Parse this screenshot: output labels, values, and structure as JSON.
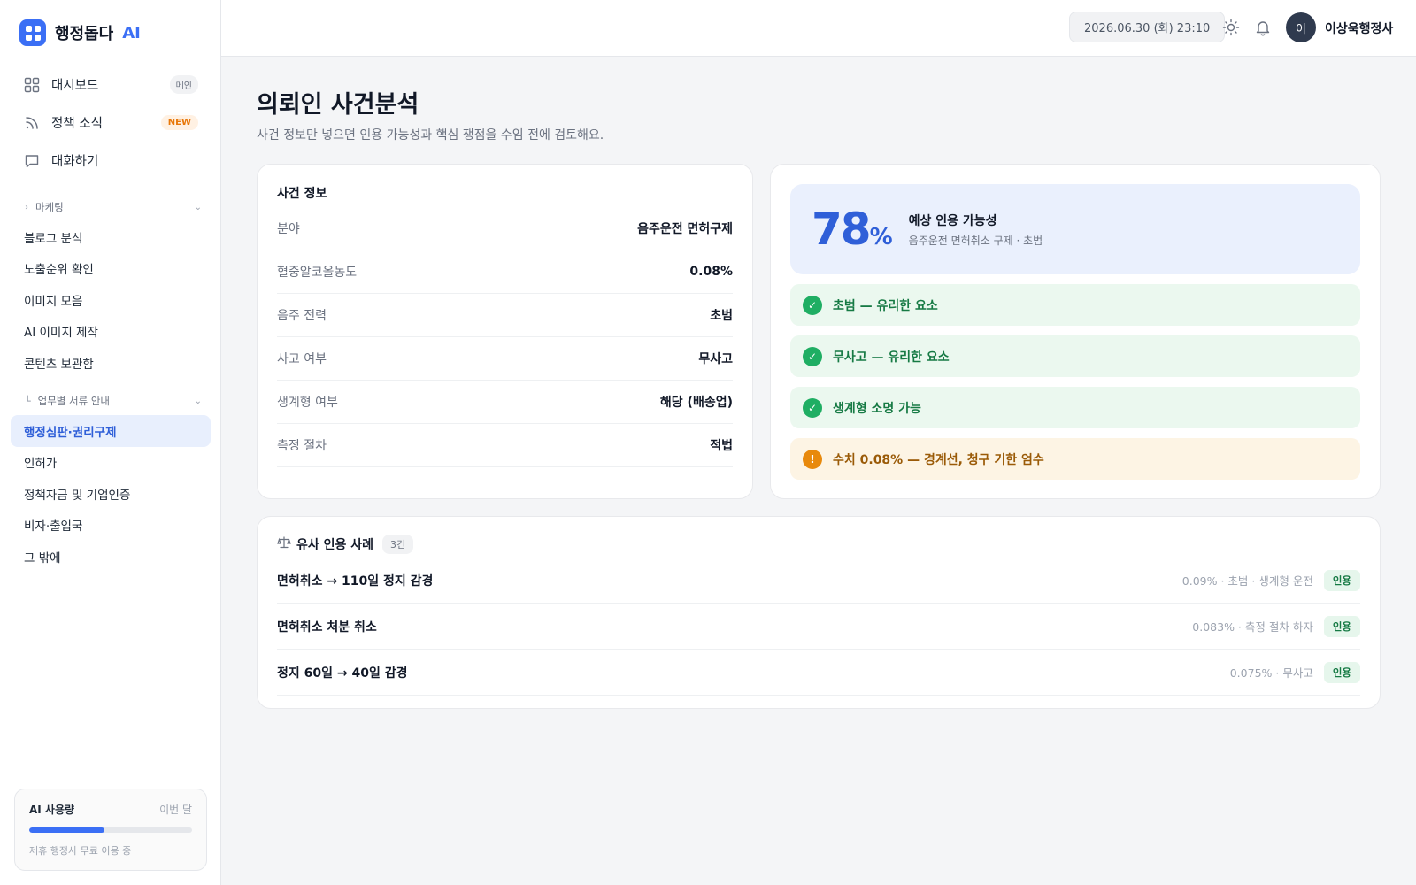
{
  "brand": {
    "name": "행정돕다",
    "ai": "AI"
  },
  "nav": [
    {
      "label": "대시보드",
      "badge": "메인",
      "icon": "grid-icon"
    },
    {
      "label": "정책 소식",
      "badge": "NEW",
      "icon": "rss-icon"
    },
    {
      "label": "대화하기",
      "icon": "chat-icon"
    }
  ],
  "sections": [
    {
      "label": "마케팅",
      "items": [
        "블로그 분석",
        "노출순위 확인",
        "이미지 모음",
        "AI 이미지 제작",
        "콘텐츠 보관함"
      ]
    },
    {
      "label": "업무별 서류 안내",
      "items": [
        "행정심판·권리구제",
        "인허가",
        "정책자금 및 기업인증",
        "비자·출입국",
        "그 밖에"
      ],
      "active_index": 0
    }
  ],
  "usage": {
    "title": "AI 사용량",
    "period": "이번 달",
    "fraction": 0.46,
    "note": "제휴 행정사 무료 이용 중"
  },
  "topbar": {
    "datetime": "2026.06.30 (화) 23:10",
    "avatar_initial": "이",
    "user_name": "이상욱행정사"
  },
  "page": {
    "title": "의뢰인 사건분석",
    "subtitle": "사건 정보만 넣으면 인용 가능성과 핵심 쟁점을 수임 전에 검토해요."
  },
  "case_info": {
    "title": "사건 정보",
    "rows": [
      {
        "key": "분야",
        "value": "음주운전 면허구제"
      },
      {
        "key": "혈중알코올농도",
        "value": "0.08%"
      },
      {
        "key": "음주 전력",
        "value": "초범"
      },
      {
        "key": "사고 여부",
        "value": "무사고"
      },
      {
        "key": "생계형 여부",
        "value": "해당 (배송업)"
      },
      {
        "key": "측정 절차",
        "value": "적법"
      }
    ]
  },
  "analysis": {
    "probability": "78",
    "percent_sign": "%",
    "prob_title": "예상 인용 가능성",
    "prob_desc": "음주운전 면허취소 구제 · 초범",
    "factors": [
      {
        "type": "good",
        "icon": "check-icon",
        "text": "초범 — 유리한 요소"
      },
      {
        "type": "good",
        "icon": "check-icon",
        "text": "무사고 — 유리한 요소"
      },
      {
        "type": "good",
        "icon": "check-icon",
        "text": "생계형 소명 가능"
      },
      {
        "type": "warn",
        "icon": "warning-icon",
        "text": "수치 0.08% — 경계선, 청구 기한 엄수"
      }
    ]
  },
  "similar_cases": {
    "title": "유사 인용 사례",
    "count": "3건",
    "items": [
      {
        "title": "면허취소 → 110일 정지 감경",
        "meta": "0.09% · 초범 · 생계형 운전",
        "tag": "인용"
      },
      {
        "title": "면허취소 처분 취소",
        "meta": "0.083% · 측정 절차 하자",
        "tag": "인용"
      },
      {
        "title": "정지 60일 → 40일 감경",
        "meta": "0.075% · 무사고",
        "tag": "인용"
      }
    ]
  },
  "colors": {
    "accent": "#3b6ff5",
    "good": "#1fae63",
    "warn": "#e8890c"
  }
}
